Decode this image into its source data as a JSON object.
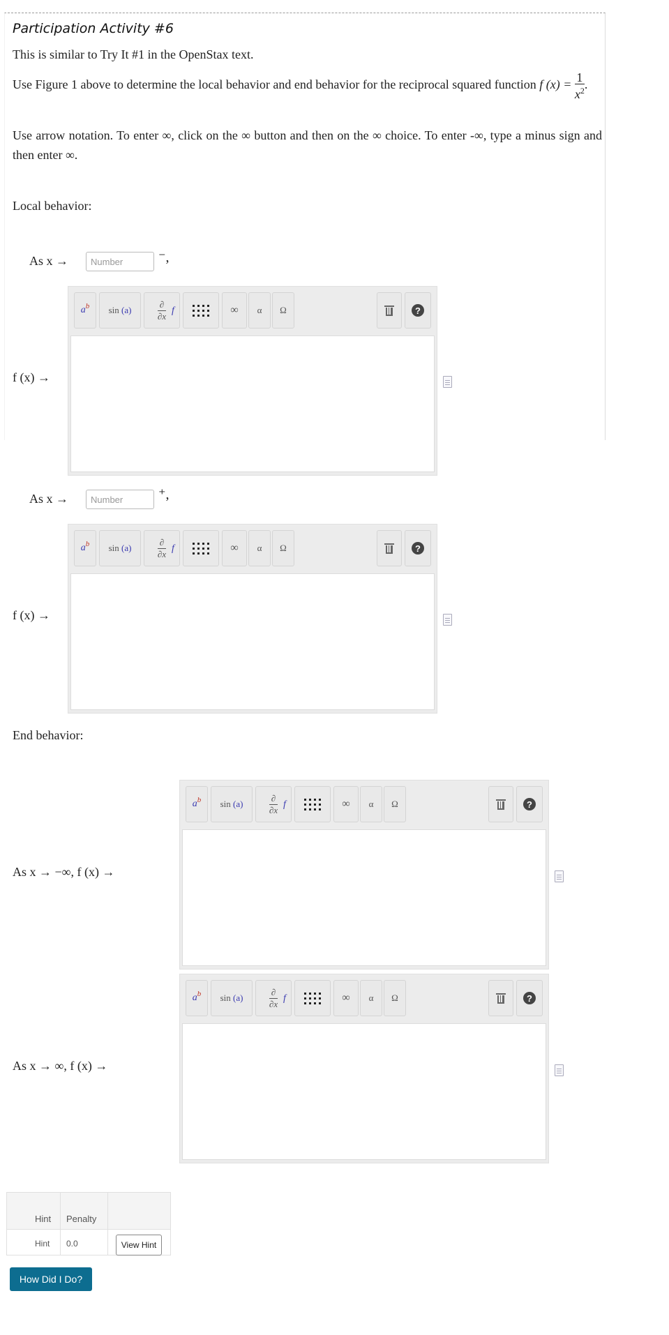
{
  "activity": {
    "title": "Participation Activity #6",
    "intro": "This is similar to Try It #1 in the OpenStax text.",
    "instruction_prefix": "Use Figure 1 above to determine the local behavior and end behavior for the reciprocal squared function",
    "function_lhs": "f (x) =",
    "function_num": "1",
    "function_den_base": "x",
    "function_den_exp": "2",
    "period": ".",
    "arrow_note": "Use arrow notation. To enter ∞, click on the ∞ button and then on the ∞ choice. To enter -∞, type a minus sign and then enter ∞."
  },
  "local": {
    "heading": "Local behavior:",
    "as_x_prefix": "As x →",
    "placeholder": "Number",
    "row1_suffix": "⁻,",
    "row2_suffix": "⁺,",
    "fx_arrow": "f (x) →"
  },
  "end": {
    "heading": "End behavior:",
    "row1_label": "As x → −∞, f (x) →",
    "row2_label": "As x → ∞, f (x) →"
  },
  "toolbar": {
    "power_base": "a",
    "power_exp": "b",
    "sin_label": "sin",
    "sin_arg": "(a)",
    "deriv_top": "∂",
    "deriv_bottom": "∂x",
    "deriv_f": "f",
    "infinity": "∞",
    "alpha": "α",
    "omega": "Ω",
    "help": "?"
  },
  "hint": {
    "col_hint": "Hint",
    "col_penalty": "Penalty",
    "row_hint": "Hint",
    "row_penalty": "0.0",
    "view_label": "View Hint"
  },
  "submit": {
    "label": "How Did I Do?"
  },
  "colors": {
    "primary_button": "#0d6d90",
    "toolbar_bg": "#ececec"
  }
}
